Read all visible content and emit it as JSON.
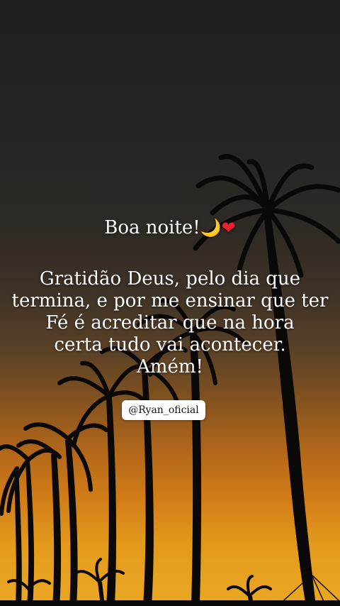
{
  "message": {
    "greeting": "Boa noite!",
    "greeting_emojis": {
      "moon": "🌙",
      "heart": "❤"
    },
    "lines": [
      "Gratidão Deus, pelo dia que",
      "termina, e por me ensinar que ter",
      "Fé é acreditar que na hora",
      "certa tudo vai acontecer.",
      "Amém!"
    ]
  },
  "watermark": {
    "handle": "@Ryan_oficial"
  },
  "scene": {
    "description_colors": {
      "sky_top": "#1f1f1f",
      "sunset": "#e39a1c",
      "silhouette": "#0b0907"
    }
  }
}
